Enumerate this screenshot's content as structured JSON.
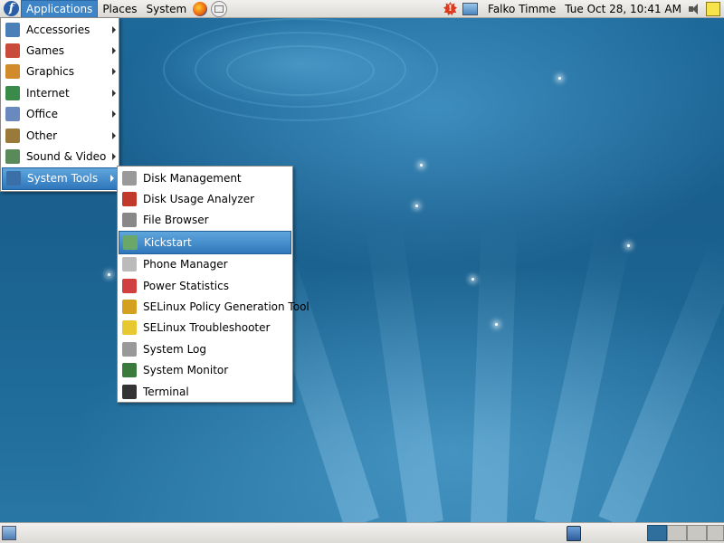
{
  "top_panel": {
    "menus": [
      {
        "label": "Applications",
        "active": true
      },
      {
        "label": "Places",
        "active": false
      },
      {
        "label": "System",
        "active": false
      }
    ],
    "launchers": [
      "firefox-icon",
      "mail-icon"
    ],
    "tray": {
      "updates_badge": "!",
      "user_name": "Falko Timme",
      "clock": "Tue Oct 28, 10:41 AM"
    }
  },
  "applications_menu": {
    "items": [
      {
        "label": "Accessories",
        "icon": "accessories-icon",
        "color": "#4a7fb8"
      },
      {
        "label": "Games",
        "icon": "games-icon",
        "color": "#c94c3a"
      },
      {
        "label": "Graphics",
        "icon": "graphics-icon",
        "color": "#d28b2a"
      },
      {
        "label": "Internet",
        "icon": "internet-icon",
        "color": "#3a8a4a"
      },
      {
        "label": "Office",
        "icon": "office-icon",
        "color": "#6a8abf"
      },
      {
        "label": "Other",
        "icon": "other-icon",
        "color": "#9a7a3a"
      },
      {
        "label": "Sound & Video",
        "icon": "sound-video-icon",
        "color": "#5a8a5a"
      },
      {
        "label": "System Tools",
        "icon": "system-tools-icon",
        "color": "#3a6fa8",
        "highlight": true
      }
    ]
  },
  "system_tools_menu": {
    "items": [
      {
        "label": "Disk Management",
        "icon": "disk-icon",
        "color": "#9a9a9a"
      },
      {
        "label": "Disk Usage Analyzer",
        "icon": "disk-usage-icon",
        "color": "#c0392b"
      },
      {
        "label": "File Browser",
        "icon": "file-browser-icon",
        "color": "#888888"
      },
      {
        "label": "Kickstart",
        "icon": "kickstart-icon",
        "color": "#6aa86a",
        "highlight": true
      },
      {
        "label": "Phone Manager",
        "icon": "phone-icon",
        "color": "#bbbbbb"
      },
      {
        "label": "Power Statistics",
        "icon": "power-stats-icon",
        "color": "#d04040"
      },
      {
        "label": "SELinux Policy Generation Tool",
        "icon": "selinux-policy-icon",
        "color": "#d4a020"
      },
      {
        "label": "SELinux Troubleshooter",
        "icon": "selinux-troubleshooter-icon",
        "color": "#e8c830"
      },
      {
        "label": "System Log",
        "icon": "system-log-icon",
        "color": "#999999"
      },
      {
        "label": "System Monitor",
        "icon": "system-monitor-icon",
        "color": "#3a7a3a"
      },
      {
        "label": "Terminal",
        "icon": "terminal-icon",
        "color": "#333333"
      }
    ]
  },
  "bottom_panel": {
    "workspaces": [
      {
        "label": "Workspace 1",
        "active": true
      },
      {
        "label": "Workspace 2",
        "active": false
      },
      {
        "label": "Workspace 3",
        "active": false
      },
      {
        "label": "Workspace 4",
        "active": false
      }
    ]
  }
}
